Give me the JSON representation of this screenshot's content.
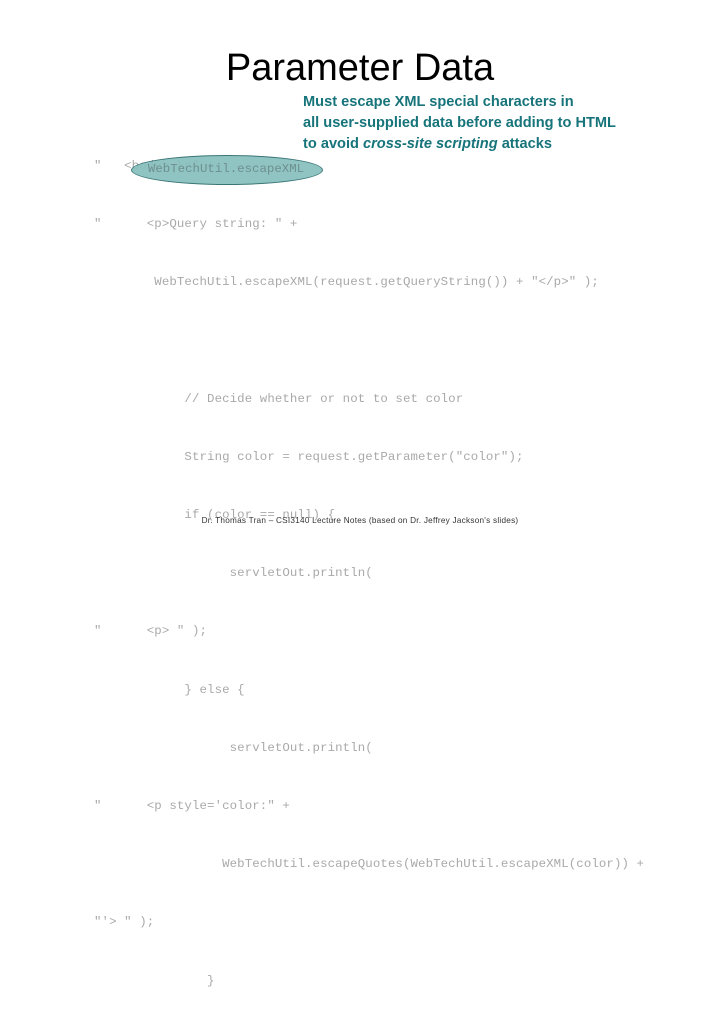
{
  "slide": {
    "title": "Parameter Data",
    "footer": "Dr. Thomas Tran – CSI3140 Lecture Notes (based on Dr. Jeffrey Jackson's slides)"
  },
  "code": {
    "lines": [
      "\"   <body> \\n\" +",
      "\"      <p>Query string: \" +",
      "        WebTechUtil.escapeXML(request.getQueryString()) + \"</p>\" );",
      "",
      "            // Decide whether or not to set color",
      "            String color = request.getParameter(\"color\");",
      "            if (color == null) {",
      "                  servletOut.println(",
      "\"      <p> \" );",
      "            } else {",
      "                  servletOut.println(",
      "\"      <p style='color:\" +",
      "                 WebTechUtil.escapeQuotes(WebTechUtil.escapeXML(color)) +",
      "\"'> \" );",
      "               }"
    ]
  },
  "highlight": {
    "label": "WebTechUtil.escapeXML",
    "fill_color": "#86bfbe",
    "border_color": "#2b6b6b"
  },
  "annotation": {
    "color": "#16747a",
    "line1": "Must escape XML special characters in",
    "line2": "all user-supplied data before adding to HTML",
    "line3_pre": "to avoid ",
    "line3_italic": "cross-site scripting",
    "line3_post": " attacks"
  }
}
